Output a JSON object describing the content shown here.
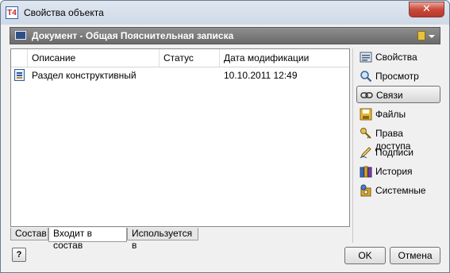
{
  "window": {
    "title": "Свойства объекта",
    "app_icon_text": "T4",
    "close_glyph": "✕"
  },
  "header": {
    "title": "Документ - Общая Пояснительная записка"
  },
  "table": {
    "columns": [
      "Описание",
      "Статус",
      "Дата модификации"
    ],
    "rows": [
      {
        "description": "Раздел конструктивный",
        "status": "",
        "modified": "10.10.2011 12:49"
      }
    ]
  },
  "tabs": [
    "Состав",
    "Входит в состав",
    "Используется в"
  ],
  "active_tab": "Входит в состав",
  "sidebar": {
    "items": [
      {
        "label": "Свойства",
        "icon": "properties-icon"
      },
      {
        "label": "Просмотр",
        "icon": "magnifier-icon"
      },
      {
        "label": "Связи",
        "icon": "link-icon"
      },
      {
        "label": "Файлы",
        "icon": "floppy-icon"
      },
      {
        "label": "Права доступа",
        "icon": "keys-icon"
      },
      {
        "label": "Подписи",
        "icon": "pen-icon"
      },
      {
        "label": "История",
        "icon": "books-icon"
      },
      {
        "label": "Системные",
        "icon": "system-icon"
      }
    ],
    "active": "Связи"
  },
  "buttons": {
    "ok": "OK",
    "cancel": "Отмена",
    "help": "?"
  },
  "colors": {
    "header_bg": "#7a7a7a",
    "close_red": "#c9493b",
    "accent_blue": "#2d5b9b"
  }
}
